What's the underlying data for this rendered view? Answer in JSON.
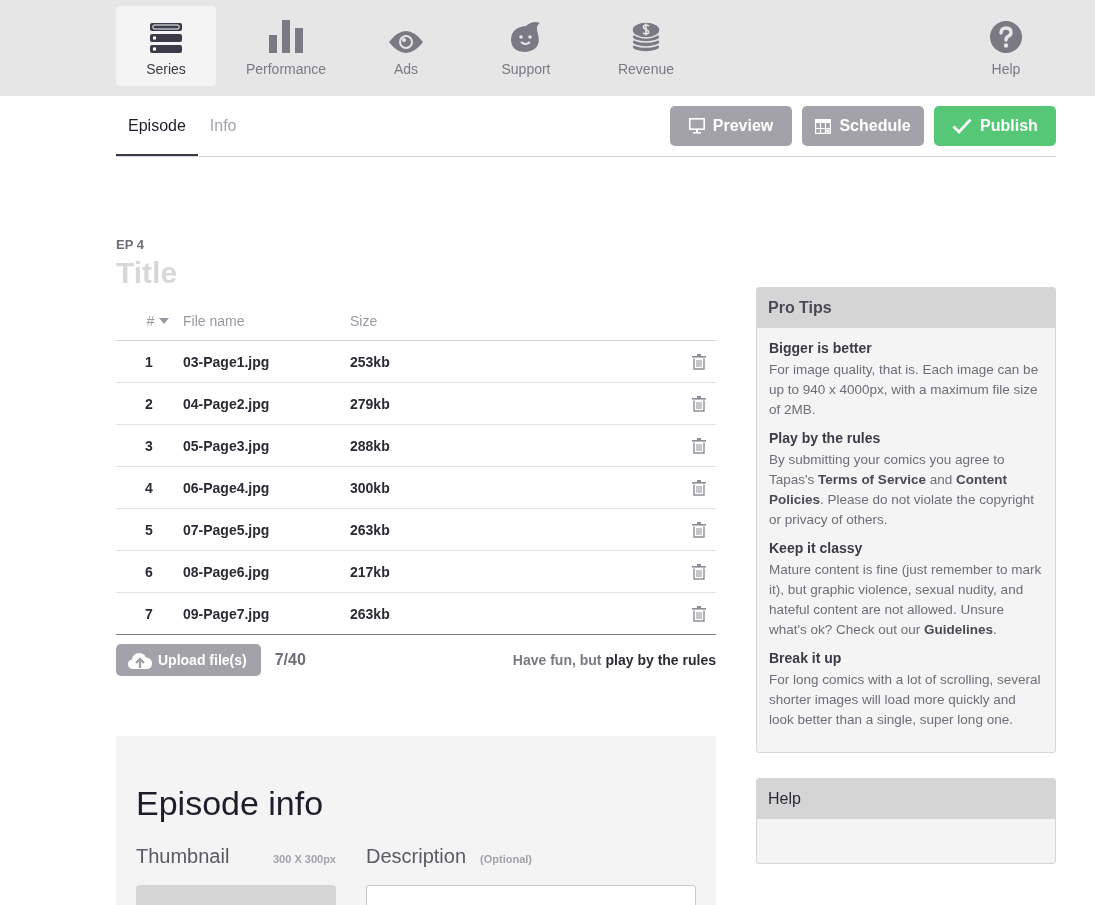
{
  "nav": {
    "items": [
      {
        "label": "Series",
        "kind": "series",
        "selected": true
      },
      {
        "label": "Performance",
        "kind": "performance",
        "selected": false
      },
      {
        "label": "Ads",
        "kind": "ads",
        "selected": false
      },
      {
        "label": "Support",
        "kind": "support",
        "selected": false
      },
      {
        "label": "Revenue",
        "kind": "revenue",
        "selected": false
      }
    ],
    "help": {
      "label": "Help",
      "selected": false
    }
  },
  "tabs": [
    {
      "label": "Episode",
      "selected": true
    },
    {
      "label": "Info",
      "selected": false
    }
  ],
  "actions": [
    {
      "label": "Preview",
      "kind": "preview"
    },
    {
      "label": "Schedule",
      "kind": "schedule"
    },
    {
      "label": "Publish",
      "kind": "publish"
    }
  ],
  "episode": {
    "number": "EP 4",
    "title": {
      "placeholder": "Title"
    }
  },
  "table": {
    "columns": [
      "#",
      "File name",
      "Size"
    ],
    "rows": [
      {
        "index": "1",
        "file": "03-Page1.jpg",
        "size": "253kb"
      },
      {
        "index": "2",
        "file": "04-Page2.jpg",
        "size": "279kb"
      },
      {
        "index": "3",
        "file": "05-Page3.jpg",
        "size": "288kb"
      },
      {
        "index": "4",
        "file": "06-Page4.jpg",
        "size": "300kb"
      },
      {
        "index": "5",
        "file": "07-Page5.jpg",
        "size": "263kb"
      },
      {
        "index": "6",
        "file": "08-Page6.jpg",
        "size": "217kb"
      },
      {
        "index": "7",
        "file": "09-Page7.jpg",
        "size": "263kb"
      }
    ]
  },
  "upload": {
    "label": "Upload file(s)",
    "count": "7/40",
    "note": "Have fun, but",
    "link": "play by the rules"
  },
  "pro_tips": {
    "title": "Pro Tips",
    "items": [
      {
        "heading": "Bigger is better",
        "body": "For image quality, that is. Each image can be up to 940 x 4000px, with a maximum file size of 2MB."
      },
      {
        "heading": "Play by the rules",
        "body": "By submitting your comics you agree to Tapas's **Terms of Service** and **Content Policies**. Please do not violate the copyright or privacy of others."
      },
      {
        "heading": "Keep it classy",
        "body": "Mature content is fine (just remember to mark it), but graphic violence, sexual nudity, and hateful content are not allowed. Unsure what's ok? Check out our **Guidelines**."
      },
      {
        "heading": "Break it up",
        "body": "For long comics with a lot of scrolling, several shorter images will load more quickly and look better than a single, super long one."
      }
    ]
  },
  "episode_info": {
    "title": "Episode info",
    "thumbnail": {
      "label": "Thumbnail",
      "hint": "300 X 300px"
    },
    "description": {
      "label": "Description",
      "hint": "(Optional)"
    }
  },
  "help_panel": {
    "title": "Help"
  }
}
